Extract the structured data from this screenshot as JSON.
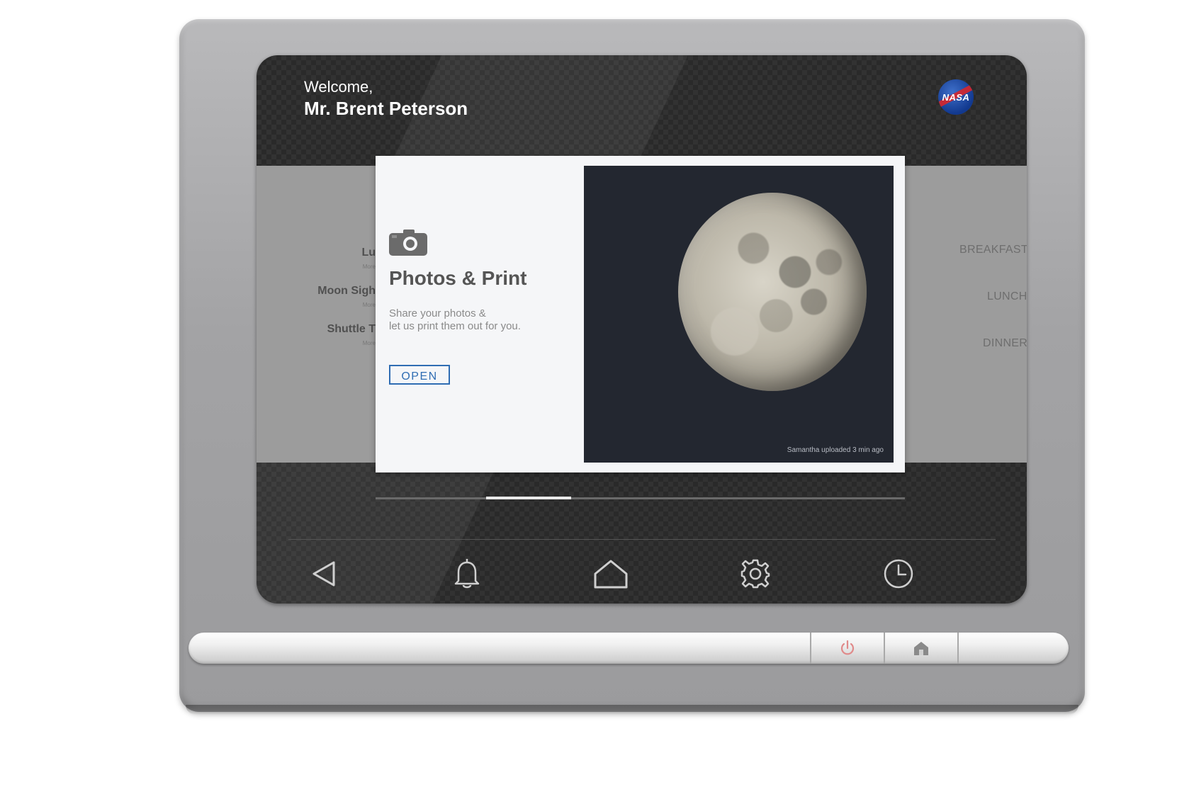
{
  "header": {
    "greeting": "Welcome,",
    "user_name": "Mr. Brent Peterson",
    "logo_text": "NASA"
  },
  "left_list": [
    {
      "title": "Lu",
      "more": "More"
    },
    {
      "title": "Moon Sigh",
      "more": "More"
    },
    {
      "title": "Shuttle T",
      "more": "More"
    }
  ],
  "right_list": [
    "BREAKFAST",
    "LUNCH",
    "DINNER"
  ],
  "card": {
    "icon": "camera-icon",
    "title": "Photos & Print",
    "desc_line1": "Share your photos &",
    "desc_line2": "let us print them out for you.",
    "open_label": "OPEN",
    "photo_caption": "Samantha uploaded 3 min ago"
  },
  "pager": {
    "pages": 6,
    "active": 2
  },
  "nav": [
    "back-icon",
    "bell-icon",
    "home-icon",
    "gear-icon",
    "clock-icon"
  ],
  "hardware_keys": [
    "power-icon",
    "home-icon"
  ],
  "colors": {
    "accent": "#2f6db3",
    "screen_bg": "#2a2a2a",
    "band": "#9c9c9c",
    "card_bg": "#f5f6f8",
    "photo_bg": "#232730"
  }
}
